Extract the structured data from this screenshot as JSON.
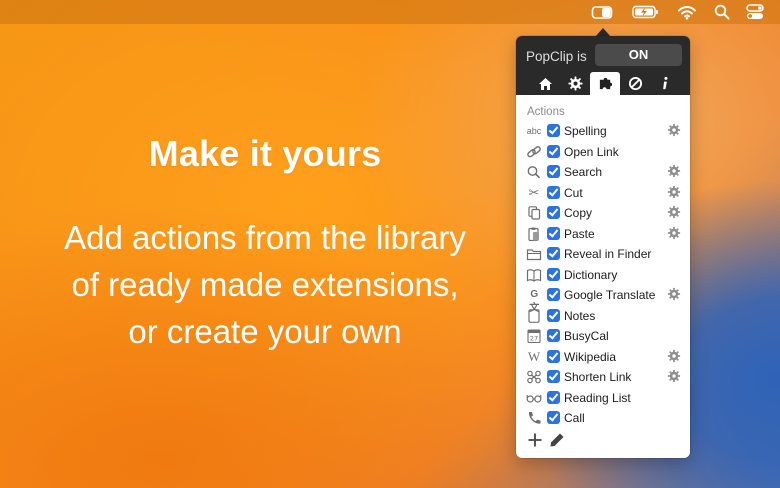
{
  "hero": {
    "title": "Make it yours",
    "line1": "Add actions from the library",
    "line2": "of ready made extensions,",
    "line3": "or create your own"
  },
  "menubar": {
    "icons": [
      "popclip-menubar-icon",
      "battery-charging-icon",
      "wifi-icon",
      "spotlight-search-icon",
      "control-center-icon"
    ]
  },
  "popup": {
    "status_label": "PopClip is",
    "toggle_label": "ON",
    "tabs": [
      {
        "icon": "house-icon"
      },
      {
        "icon": "gear-icon"
      },
      {
        "icon": "puzzle-icon"
      },
      {
        "icon": "block-icon"
      },
      {
        "icon": "info-icon"
      }
    ],
    "section_label": "Actions",
    "actions": [
      {
        "label": "Spelling",
        "icon": "abc",
        "checked": true,
        "has_settings": true
      },
      {
        "label": "Open Link",
        "icon": "link",
        "checked": true,
        "has_settings": false
      },
      {
        "label": "Search",
        "icon": "magnifier",
        "checked": true,
        "has_settings": true
      },
      {
        "label": "Cut",
        "icon": "scissors",
        "checked": true,
        "has_settings": true
      },
      {
        "label": "Copy",
        "icon": "copy",
        "checked": true,
        "has_settings": true
      },
      {
        "label": "Paste",
        "icon": "clipboard",
        "checked": true,
        "has_settings": true
      },
      {
        "label": "Reveal in Finder",
        "icon": "folder",
        "checked": true,
        "has_settings": false
      },
      {
        "label": "Dictionary",
        "icon": "book",
        "checked": true,
        "has_settings": false
      },
      {
        "label": "Google Translate",
        "icon": "translate",
        "checked": true,
        "has_settings": true
      },
      {
        "label": "Notes",
        "icon": "note",
        "checked": true,
        "has_settings": false
      },
      {
        "label": "BusyCal",
        "icon": "calendar",
        "checked": true,
        "has_settings": false
      },
      {
        "label": "Wikipedia",
        "icon": "wikipedia",
        "checked": true,
        "has_settings": true
      },
      {
        "label": "Shorten Link",
        "icon": "chain",
        "checked": true,
        "has_settings": true
      },
      {
        "label": "Reading List",
        "icon": "glasses",
        "checked": true,
        "has_settings": false
      },
      {
        "label": "Call",
        "icon": "phone",
        "checked": true,
        "has_settings": false
      }
    ],
    "footer": {
      "add_icon": "plus-icon",
      "edit_icon": "pencil-icon"
    }
  },
  "colors": {
    "accent": "#2b73e0",
    "popup_header": "#2a2a2a",
    "background_orange": "#f59614",
    "background_blue": "#2f63b8"
  }
}
